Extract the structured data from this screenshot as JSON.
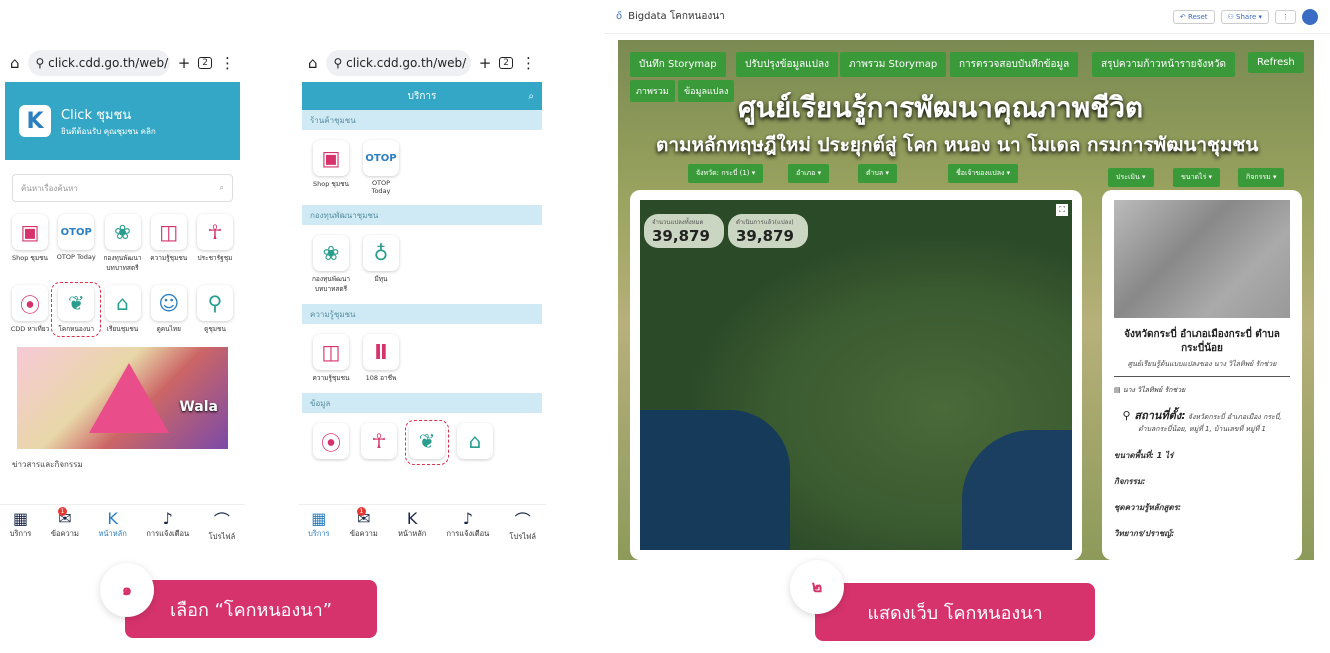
{
  "phone1": {
    "url": "click.cdd.go.th/web/",
    "tab_count": "2",
    "app_title": "Click ชุมชน",
    "welcome": "ยินดีต้อนรับ คุณชุมชน คลิก",
    "search_placeholder": "ค้นหาเรื่องค้นหา",
    "apps_row1": [
      "Shop ชุมชน",
      "OTOP Today",
      "กองทุนพัฒนา บทบาทสตรี",
      "ความรู้ชุมชน",
      "ประชารัฐชุม"
    ],
    "apps_row2": [
      "CDD หาเที่ยว",
      "โคกหนองนา",
      "เรียนชุมชน",
      "ดูคนไทย",
      "ดูชุมชน"
    ],
    "promo_text": "Wala",
    "news_label": "ข่าวสารและกิจกรรม"
  },
  "phone2": {
    "url": "click.cdd.go.th/web/",
    "tab_count": "2",
    "header": "บริการ",
    "sec1": "ร้านค้าชุมชน",
    "sec1_apps": [
      "Shop ชุมชน",
      "OTOP Today"
    ],
    "sec2": "กองทุนพัฒนาชุมชน",
    "sec2_apps": [
      "กองทุนพัฒนา บทบาทสตรี",
      "มีทุน"
    ],
    "sec3": "ความรู้ชุมชน",
    "sec3_apps": [
      "ความรู้ชุมชน",
      "108 อาชีพ"
    ],
    "sec4": "ข้อมูล"
  },
  "bottom_nav": [
    "บริการ",
    "ข้อความ",
    "หน้าหลัก",
    "การแจ้งเตือน",
    "โปรไฟล์"
  ],
  "web": {
    "app_title": "Bigdata โคกหนองนา",
    "reset": "Reset",
    "share": "Share",
    "buttons": [
      "บันทึก Storymap",
      "ปรับปรุงข้อมูลแปลง",
      "ภาพรวม Storymap",
      "การตรวจสอบบันทึกข้อมูล",
      "สรุปความก้าวหน้ารายจังหวัด",
      "Refresh",
      "ภาพรวม",
      "ข้อมูลแปลง"
    ],
    "title1": "ศูนย์เรียนรู้การพัฒนาคุณภาพชีวิต",
    "title2": "ตามหลักทฤษฎีใหม่ ประยุกต์สู่ โคก หนอง นา โมเดล กรมการพัฒนาชุมชน",
    "filters": [
      "จังหวัด: กระบี่ (1)",
      "อำเภอ",
      "ตำบล",
      "ชื่อเจ้าของแปลง"
    ],
    "filters_right": [
      "ประเมิน",
      "ขนาดไร่",
      "กิจกรรม"
    ],
    "stat1_label": "จำนวนแปลงทั้งหมด",
    "stat1_value": "39,879",
    "stat2_label": "ดำเนินการแล้ว(แปลง)",
    "stat2_value": "39,879",
    "info_title": "จังหวัดกระบี่ อำเภอเมืองกระบี่ ตำบลกระบี่น้อย",
    "info_sub": "ศูนย์เรียนรู้ต้นแบบแปลงของ นาง วิไลทิพย์ รักช่วย",
    "owner": "นาง วิไลทิพย์ รักช่วย",
    "loc_label": "สถานที่ตั้ง:",
    "loc_text": "จังหวัดกระบี่ อำเภอเมือง กระบี่, ตำบลกระบี่น้อย, หมู่ที่ 1, บ้านเลขที่ หมู่ที่ 1",
    "fields": [
      "ขนาดพื้นที่: 1 ไร่",
      "กิจกรรม:",
      "ชุดความรู้หลักสูตร:",
      "วิทยากร/ปราชญ์:"
    ]
  },
  "steps": [
    {
      "num": "๑",
      "label": "เลือก “โคกหนองนา”"
    },
    {
      "num": "๒",
      "label": "แสดงเว็บ โคกหนองนา"
    }
  ]
}
